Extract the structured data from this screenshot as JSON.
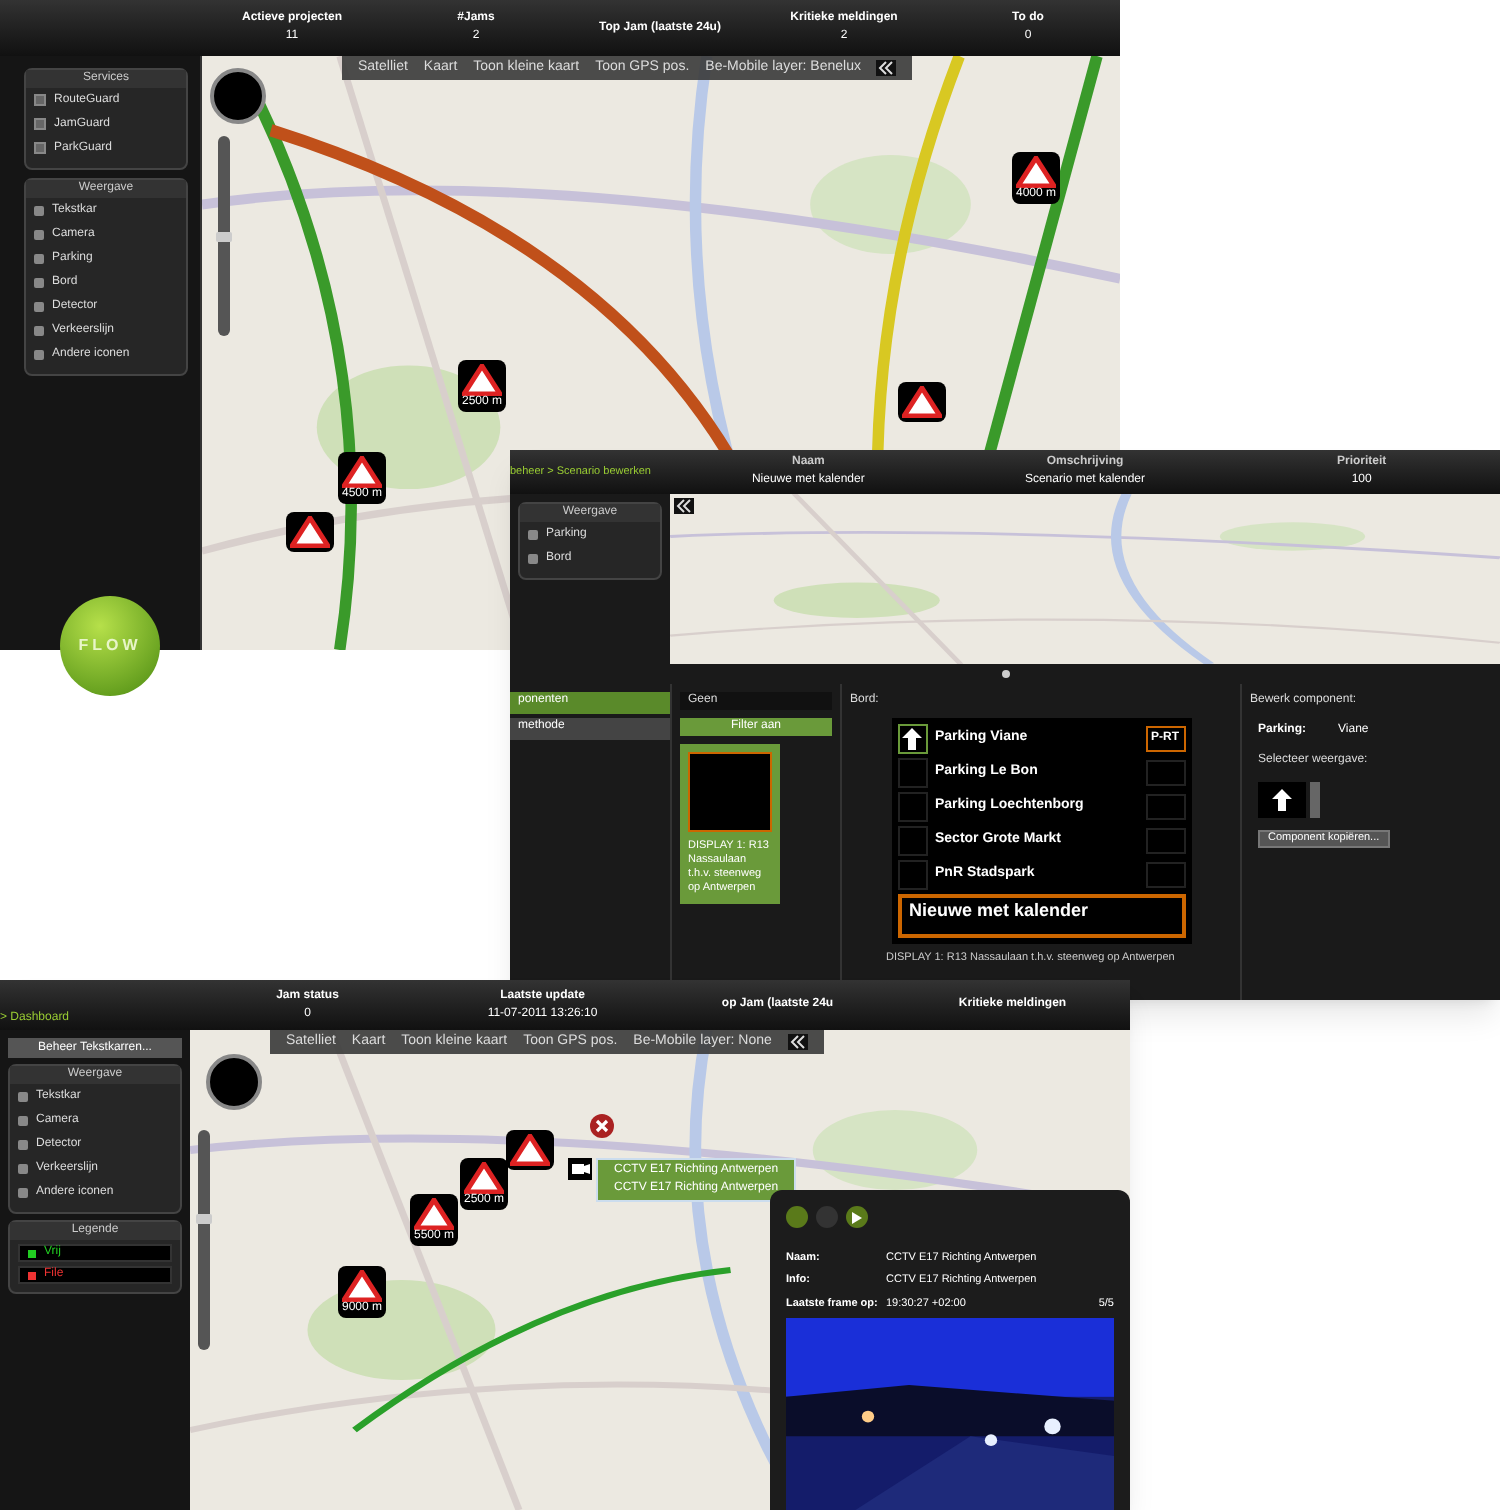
{
  "top_window": {
    "stats": [
      {
        "label": "Actieve projecten",
        "value": "11"
      },
      {
        "label": "#Jams",
        "value": "2"
      },
      {
        "label": "Top Jam (laatste 24u)"
      },
      {
        "label": "Kritieke meldingen",
        "value": "2"
      },
      {
        "label": "To do",
        "value": "0"
      }
    ],
    "services": {
      "title": "Services",
      "items": [
        {
          "label": "RouteGuard",
          "checked": true
        },
        {
          "label": "JamGuard",
          "checked": true
        },
        {
          "label": "ParkGuard",
          "checked": true
        }
      ]
    },
    "view": {
      "title": "Weergave",
      "items": [
        "Tekstkar",
        "Camera",
        "Parking",
        "Bord",
        "Detector",
        "Verkeerslijn",
        "Andere iconen"
      ]
    },
    "logo": "FLOW",
    "map_toolbar": [
      "Satelliet",
      "Kaart",
      "Toon kleine kaart",
      "Toon GPS pos.",
      "Be-Mobile layer: Benelux"
    ],
    "zoom": {
      "level": 0.5
    },
    "markers": [
      {
        "kind": "warning",
        "label": "4000 m"
      },
      {
        "kind": "warning",
        "label": "2500 m"
      },
      {
        "kind": "warning",
        "label": "4500 m"
      },
      {
        "kind": "warning"
      },
      {
        "kind": "warning"
      }
    ]
  },
  "scenario_window": {
    "breadcrumb": "beheer > Scenario bewerken",
    "columns": [
      {
        "label": "Naam",
        "value": "Nieuwe met kalender"
      },
      {
        "label": "Omschrijving",
        "value": "Scenario met kalender"
      },
      {
        "label": "Prioriteit",
        "value": "100"
      }
    ],
    "view": {
      "title": "Weergave",
      "items": [
        "Parking",
        "Bord"
      ]
    },
    "menu": [
      {
        "label": "ponenten",
        "selected": true
      },
      {
        "label": "methode",
        "selected": false
      }
    ],
    "filter": {
      "value": "Geen",
      "button": "Filter aan",
      "caption": "DISPLAY 1: R13 Nassaulaan t.h.v. steenweg op Antwerpen"
    },
    "bord": {
      "title": "Bord:",
      "rows": [
        {
          "label": "Parking Viane",
          "arrow": true,
          "badge": "P-RT"
        },
        {
          "label": "Parking Le Bon",
          "arrow": false
        },
        {
          "label": "Parking Loechtenborg",
          "arrow": false
        },
        {
          "label": "Sector Grote Markt",
          "arrow": false
        },
        {
          "label": "PnR Stadspark",
          "arrow": false
        }
      ],
      "message": {
        "text": "Nieuwe met kalender",
        "selected": true
      },
      "caption": "DISPLAY 1: R13 Nassaulaan t.h.v. steenweg op Antwerpen"
    },
    "component": {
      "title": "Bewerk component:",
      "field": "Parking:",
      "value": "Viane",
      "select_label": "Selecteer weergave:",
      "button": "Component kopiëren..."
    }
  },
  "bottom_window": {
    "breadcrumb": "> Dashboard",
    "stats": [
      {
        "label": "Jam status",
        "value": "0"
      },
      {
        "label": "Laatste update",
        "value": "11-07-2011 13:26:10"
      },
      {
        "label": "op Jam (laatste 24u"
      },
      {
        "label": "Kritieke meldingen"
      }
    ],
    "manage_button": "Beheer Tekstkarren...",
    "view": {
      "title": "Weergave",
      "items": [
        "Tekstkar",
        "Camera",
        "Detector",
        "Verkeerslijn",
        "Andere iconen"
      ]
    },
    "legend": {
      "title": "Legende",
      "items": [
        {
          "label": "Vrij",
          "color": "#22cc22"
        },
        {
          "label": "File",
          "color": "#ee3333"
        }
      ]
    },
    "map_toolbar": [
      "Satelliet",
      "Kaart",
      "Toon kleine kaart",
      "Toon GPS pos.",
      "Be-Mobile layer: None"
    ],
    "zoom": {
      "level": 0.6
    },
    "markers": [
      {
        "kind": "warning",
        "label": "9000 m"
      },
      {
        "kind": "warning",
        "label": "5500 m"
      },
      {
        "kind": "warning",
        "label": "2500 m"
      },
      {
        "kind": "warning"
      }
    ],
    "tooltip": [
      "CCTV E17 Richting Antwerpen",
      "CCTV E17 Richting Antwerpen"
    ],
    "camera": {
      "rows": [
        {
          "label": "Naam:",
          "value": "CCTV E17 Richting Antwerpen"
        },
        {
          "label": "Info:",
          "value": "CCTV E17 Richting Antwerpen"
        },
        {
          "label": "Laatste frame op:",
          "value": "19:30:27 +02:00"
        }
      ],
      "counter": "5/5"
    }
  }
}
